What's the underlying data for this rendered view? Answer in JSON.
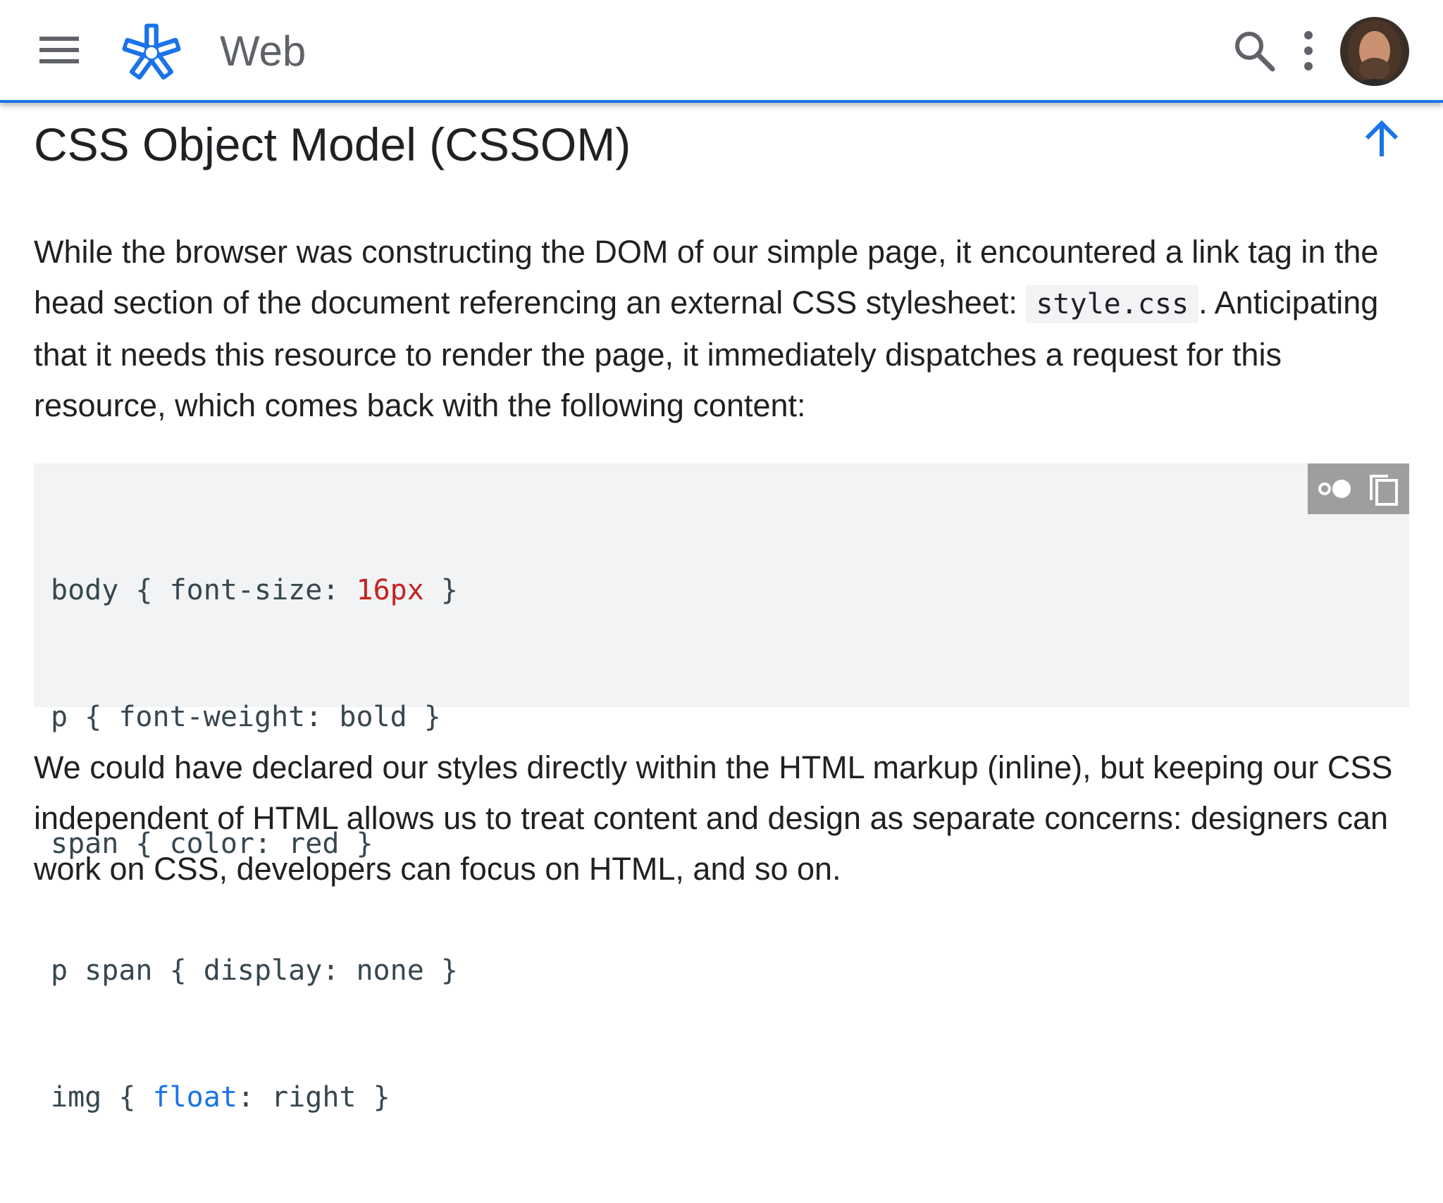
{
  "header": {
    "title": "Web",
    "menu_icon": "hamburger-menu-icon",
    "logo_icon": "asterisk-logo-icon",
    "search_icon": "search-icon",
    "more_icon": "more-vert-icon",
    "accent_color": "#1a73e8"
  },
  "article": {
    "title": "CSS Object Model (CSSOM)",
    "back_to_top_icon": "arrow-up-icon",
    "paragraph1": {
      "before_code": "While the browser was constructing the DOM of our simple page, it encountered a link tag in the head section of the document referencing an external CSS stylesheet: ",
      "code": "style.css",
      "after_code": ". Anticipating that it needs this resource to render the page, it immediately dispatches a request for this resource, which comes back with the following content:"
    },
    "code_block": {
      "lines": [
        {
          "pre": "body { font-size: ",
          "highlight": "16px",
          "post": " }"
        },
        {
          "pre": "p { font-weight: bold }",
          "highlight": "",
          "post": ""
        },
        {
          "pre": "span { color: red }",
          "highlight": "",
          "post": ""
        },
        {
          "pre": "p span { display: none }",
          "highlight": "",
          "post": ""
        },
        {
          "pre": "img { ",
          "highlight": "float",
          "post": ": right }"
        }
      ],
      "dark_mode_icon": "dark-mode-toggle-icon",
      "copy_icon": "copy-icon"
    },
    "paragraph2": "We could have declared our styles directly within the HTML markup (inline), but keeping our CSS independent of HTML allows us to treat content and design as separate concerns: designers can work on CSS, developers can focus on HTML, and so on."
  }
}
